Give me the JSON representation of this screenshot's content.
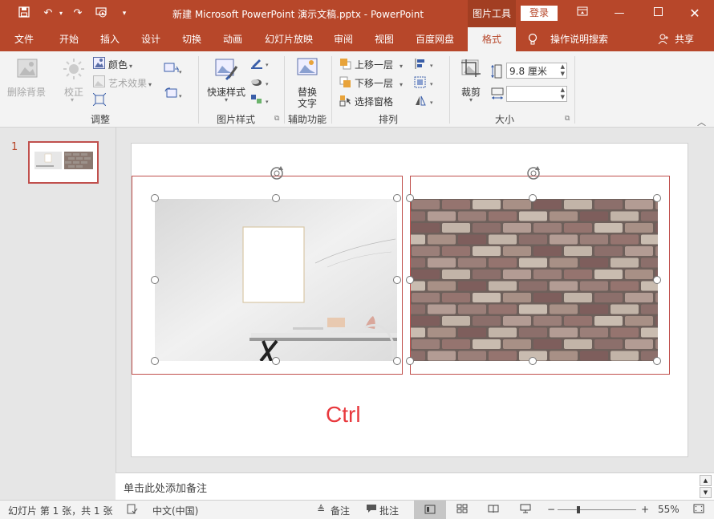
{
  "titlebar": {
    "title": "新建 Microsoft PowerPoint 演示文稿.pptx  -  PowerPoint",
    "context_tab": "图片工具",
    "login": "登录"
  },
  "tabs": [
    "文件",
    "开始",
    "插入",
    "设计",
    "切换",
    "动画",
    "幻灯片放映",
    "审阅",
    "视图",
    "百度网盘",
    "格式"
  ],
  "active_tab": "格式",
  "tell_me": "操作说明搜索",
  "share": "共享",
  "ribbon": {
    "adjust": {
      "remove_bg": "删除背景",
      "correct": "校正",
      "color": "颜色",
      "art_effects": "艺术效果",
      "label": "调整"
    },
    "picture_styles": {
      "quick_styles": "快速样式",
      "label": "图片样式"
    },
    "accessibility": {
      "alt_text": "替换文字",
      "alt_text_line1": "替换",
      "alt_text_line2": "文字",
      "label": "辅助功能"
    },
    "arrange": {
      "bring_forward": "上移一层",
      "send_backward": "下移一层",
      "selection_pane": "选择窗格",
      "label": "排列"
    },
    "size": {
      "crop": "裁剪",
      "height_value": "9.8 厘米",
      "width_value": "",
      "label": "大小"
    }
  },
  "thumbnails": {
    "slide_number": "1"
  },
  "slide": {
    "overlay_text": "Ctrl"
  },
  "notes": {
    "placeholder": "单击此处添加备注"
  },
  "statusbar": {
    "slide_info": "幻灯片 第 1 张，共 1 张",
    "language": "中文(中国)",
    "notes": "备注",
    "comments": "批注",
    "zoom": "55%"
  },
  "colors": {
    "accent": "#b7472a",
    "selection": "#c0504d",
    "ctrl_text": "#e8383d"
  }
}
